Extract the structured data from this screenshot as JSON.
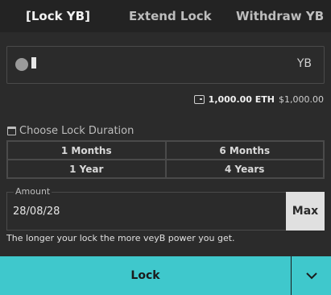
{
  "tabs": [
    {
      "label": "[Lock YB]",
      "active": true
    },
    {
      "label": "Extend Lock",
      "active": false
    },
    {
      "label": "Withdraw YB",
      "active": false
    }
  ],
  "amount_input": {
    "token": "YB",
    "coin_icon": "coin-icon"
  },
  "balance": {
    "icon": "wallet-icon",
    "amount": "1,000.00 ETH",
    "usd": "$1,000.00"
  },
  "duration": {
    "heading": "Choose Lock Duration",
    "icon": "calendar-icon",
    "options": [
      "1 Months",
      "6 Months",
      "1 Year",
      "4 Years"
    ]
  },
  "date_field": {
    "legend": "Amount",
    "value": "28/08/28",
    "max_label": "Max"
  },
  "hint": "The longer your lock the more veyB power you get.",
  "actions": {
    "lock_label": "Lock",
    "dropdown_icon": "chevron-down-icon"
  },
  "colors": {
    "background": "#2b2b2b",
    "accent": "#3fc8cc",
    "border": "#4a4a4a"
  }
}
